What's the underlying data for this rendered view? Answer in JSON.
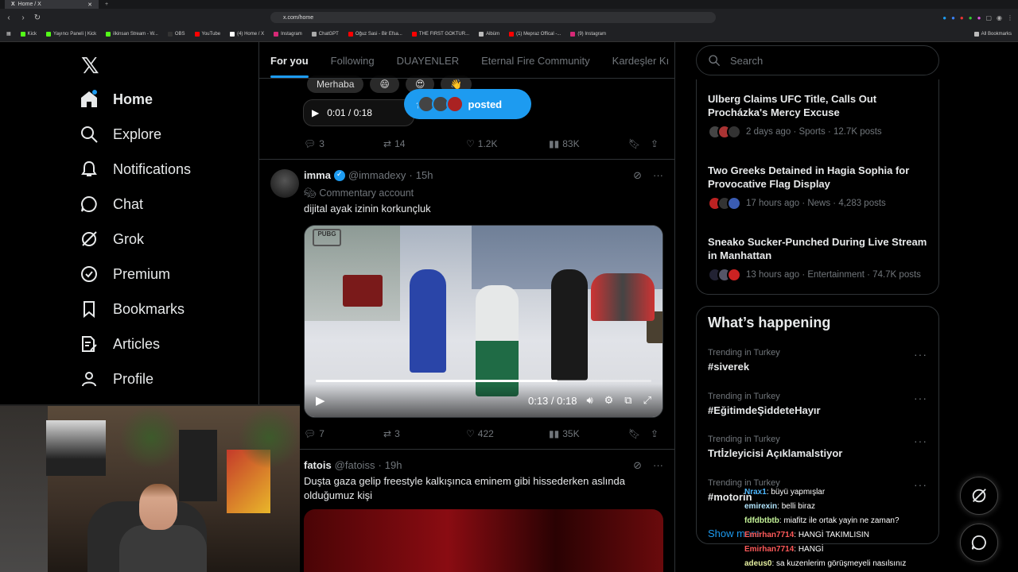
{
  "browser": {
    "tab_title": "Home / X",
    "url": "x.com/home",
    "bookmarks": [
      "Kick",
      "Yayıncı Paneli | Kick",
      "ilkinsan Stream - W...",
      "OBS",
      "YouTube",
      "(4) Home / X",
      "Instagram",
      "ChatGPT",
      "Oğuz Sasi - Bir Efsa...",
      "THE FIRST GOKTUR...",
      "Albüm",
      "(1) Mepraz Offical -...",
      "(9) Instagram"
    ],
    "all_bookmarks": "All Bookmarks"
  },
  "nav": {
    "items": [
      {
        "label": "Home"
      },
      {
        "label": "Explore"
      },
      {
        "label": "Notifications"
      },
      {
        "label": "Chat"
      },
      {
        "label": "Grok"
      },
      {
        "label": "Premium"
      },
      {
        "label": "Bookmarks"
      },
      {
        "label": "Articles"
      },
      {
        "label": "Profile"
      }
    ]
  },
  "timeline": {
    "tabs": [
      "For you",
      "Following",
      "DUAYENLER",
      "Eternal Fire Community",
      "Kardeşler Kı"
    ],
    "posted_pill": "posted",
    "prev_post": {
      "chat_chip": "Merhaba",
      "time": "0:01 / 0:18",
      "replies": "3",
      "reposts": "14",
      "likes": "1.2K",
      "views": "83K"
    },
    "post1": {
      "name": "imma",
      "handle": "@immadexy",
      "dot": "·",
      "time": "15h",
      "label": "Commentary account",
      "text": "dijital ayak izinin korkunçluk",
      "video_time": "0:13 / 0:18",
      "progress": 0.72,
      "replies": "7",
      "reposts": "3",
      "likes": "422",
      "views": "35K"
    },
    "post2": {
      "name": "fatois",
      "handle": "@fatoiss",
      "dot": "·",
      "time": "19h",
      "text": "Duşta gaza gelip freestyle kalkışınca eminem gibi hissederken aslında olduğumuz kişi"
    }
  },
  "right": {
    "search_placeholder": "Search",
    "news": [
      {
        "title": "Ulberg Claims UFC Title, Calls Out Procházka's Mercy Excuse",
        "meta": "2 days ago · Sports · 12.7K posts"
      },
      {
        "title": "Two Greeks Detained in Hagia Sophia for Provocative Flag Display",
        "meta": "17 hours ago · News · 4,283 posts"
      },
      {
        "title": "Sneako Sucker-Punched During Live Stream in Manhattan",
        "meta": "13 hours ago · Entertainment · 74.7K posts"
      }
    ],
    "happening_title": "What’s happening",
    "trends": [
      {
        "context": "Trending in Turkey",
        "tag": "#siverek"
      },
      {
        "context": "Trending in Turkey",
        "tag": "#EğitimdeŞiddeteHayır"
      },
      {
        "context": "Trending in Turkey",
        "tag": "Trtİzleyicisi Açıklamalstiyor"
      },
      {
        "context": "Trending in Turkey",
        "tag": "#motorin"
      }
    ],
    "show_more": "Show more"
  },
  "stream_chat": [
    {
      "user": "Nrax1",
      "msg": "büyü yapmışlar",
      "color": "#4db8ff"
    },
    {
      "user": "emirexin",
      "msg": "belli biraz",
      "color": "#b3e6ff"
    },
    {
      "user": "fdfdbtbtb",
      "msg": "miafitz ile ortak yayin ne zaman?",
      "color": "#c6f59a"
    },
    {
      "user": "Emirhan7714",
      "msg": "HANGİ TAKIMLISIN",
      "color": "#ff5a5a"
    },
    {
      "user": "Emirhan7714",
      "msg": "HANGİ",
      "color": "#ff5a5a"
    },
    {
      "user": "adeus0",
      "msg": "sa kuzenlerim görüşmeyeli nasılsınız",
      "color": "#e6f0a0"
    }
  ],
  "colors": {
    "accent": "#1d9bf0",
    "bg": "#000000",
    "text": "#e7e9ea",
    "muted": "#71767b"
  }
}
